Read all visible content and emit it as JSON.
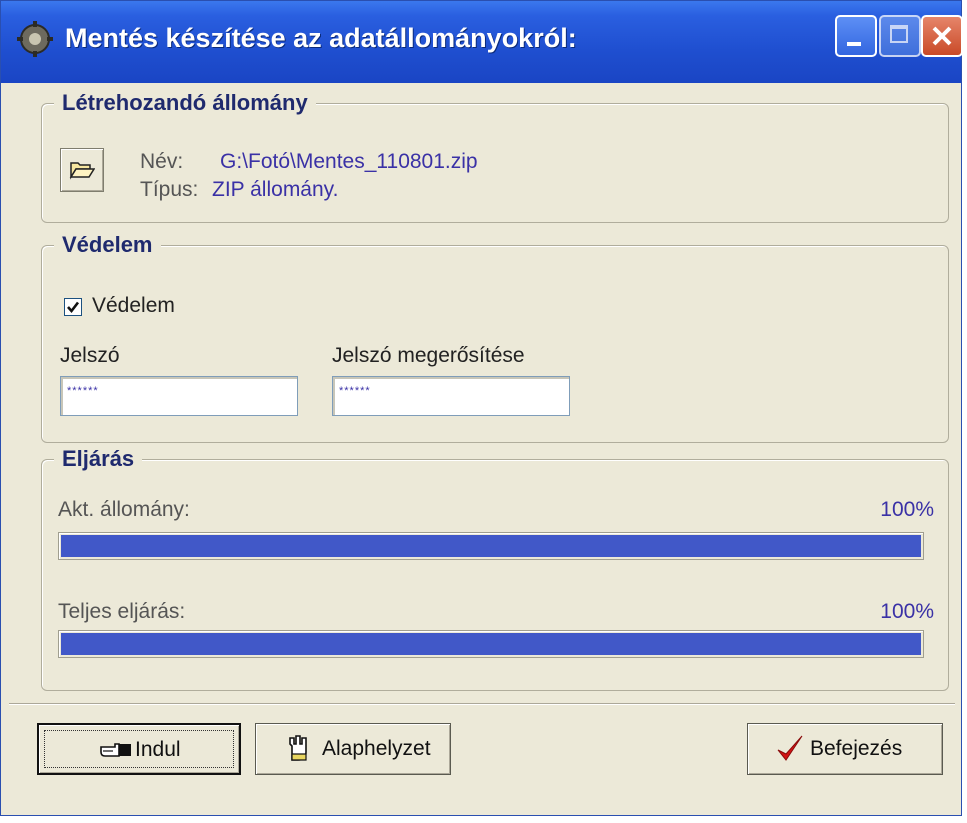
{
  "window": {
    "title": "Mentés készítése az adatállományokról:",
    "accent": "#2a5fe0"
  },
  "file_group": {
    "legend": "Létrehozandó állomány",
    "name_label": "Név:",
    "name_value": "G:\\Fotó\\Mentes_110801.zip",
    "type_label": "Típus:",
    "type_value": "ZIP állomány."
  },
  "protection_group": {
    "legend": "Védelem",
    "checkbox_label": "Védelem",
    "checkbox_checked": true,
    "password_label": "Jelszó",
    "password_value": "******",
    "confirm_label": "Jelszó megerősítése",
    "confirm_value": "******"
  },
  "process_group": {
    "legend": "Eljárás",
    "current_label": "Akt. állomány:",
    "current_percent": "100%",
    "current_fraction": 1.0,
    "total_label": "Teljes eljárás:",
    "total_percent": "100%",
    "total_fraction": 1.0,
    "bar_color": "#4158c8"
  },
  "buttons": {
    "start": "Indul",
    "reset": "Alaphelyzet",
    "finish": "Befejezés"
  }
}
